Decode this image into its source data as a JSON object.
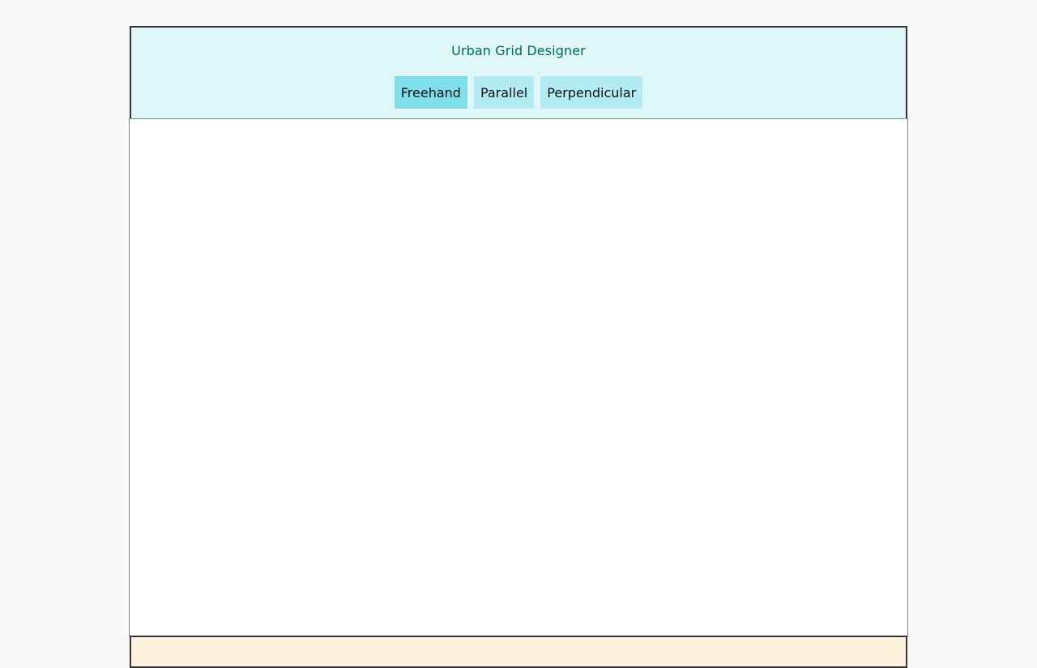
{
  "app": {
    "title": "Urban Grid Designer"
  },
  "toolbar": {
    "tools": [
      {
        "label": "Freehand",
        "active": true
      },
      {
        "label": "Parallel",
        "active": false
      },
      {
        "label": "Perpendicular",
        "active": false
      }
    ]
  },
  "colors": {
    "page_background": "#f9f9f9",
    "header_background": "#e0f7fa",
    "title_text": "#00695c",
    "button_background": "#b2ebf2",
    "button_active_background": "#80deea",
    "canvas_background": "#ffffff",
    "footer_background": "#fff3e0",
    "frame_border": "#333333"
  }
}
